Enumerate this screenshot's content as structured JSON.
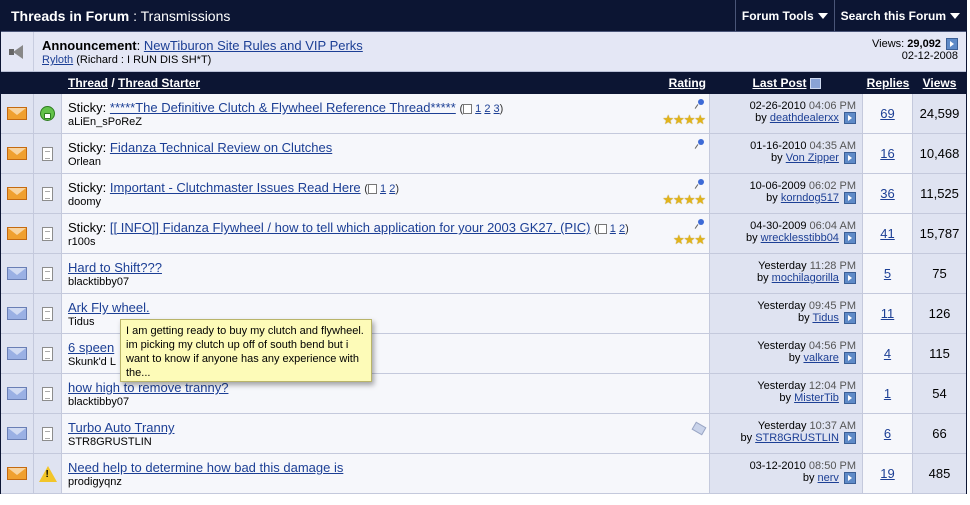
{
  "header": {
    "title_bold": "Threads in Forum",
    "title_rest": ": Transmissions",
    "forum_tools": "Forum Tools",
    "search_forum": "Search this Forum"
  },
  "announcement": {
    "label": "Announcement",
    "title": "NewTiburon Site Rules and VIP Perks",
    "author": "Ryloth",
    "author_title": "(Richard : I RUN DIS SH*T)",
    "views_label": "Views:",
    "views": "29,092",
    "date": "02-12-2008"
  },
  "columns": {
    "thread": "Thread",
    "sep": "/",
    "starter": "Thread Starter",
    "rating": "Rating",
    "last_post": "Last Post",
    "replies": "Replies",
    "views": "Views"
  },
  "tooltip": "I am getting ready to buy my clutch and flywheel. im picking my clutch up off of south bend but i want to know if anyone has any experience with the...",
  "threads": [
    {
      "prefix": "Sticky:",
      "title": "*****The Definitive Clutch & Flywheel Reference Thread*****",
      "pages": "1 2 3",
      "starter": "aLiEn_sPoReZ",
      "date": "02-26-2010",
      "time": "04:06 PM",
      "by": "by",
      "last_user": "deathdealerxx",
      "replies": "69",
      "views": "24,599",
      "stars": "★★★★"
    },
    {
      "prefix": "Sticky:",
      "title": "Fidanza Technical Review on Clutches",
      "pages": "",
      "starter": "Orlean",
      "date": "01-16-2010",
      "time": "04:35 AM",
      "by": "by",
      "last_user": "Von Zipper",
      "replies": "16",
      "views": "10,468",
      "stars": ""
    },
    {
      "prefix": "Sticky:",
      "title": "Important - Clutchmaster Issues Read Here",
      "pages": "1 2",
      "starter": "doomy",
      "date": "10-06-2009",
      "time": "06:02 PM",
      "by": "by",
      "last_user": "korndog517",
      "replies": "36",
      "views": "11,525",
      "stars": "★★★★"
    },
    {
      "prefix": "Sticky:",
      "title": "[[ INFO]] Fidanza Flywheel / how to tell which application for your 2003 GK27. (PIC)",
      "pages": "1 2",
      "starter": "r100s",
      "date": "04-30-2009",
      "time": "06:04 AM",
      "by": "by",
      "last_user": "wrecklesstibb04",
      "replies": "41",
      "views": "15,787",
      "stars": "★★★"
    },
    {
      "prefix": "",
      "title": "Hard to Shift???",
      "pages": "",
      "starter": "blacktibby07",
      "date": "Yesterday",
      "time": "11:28 PM",
      "by": "by",
      "last_user": "mochilagorilla",
      "replies": "5",
      "views": "75",
      "stars": ""
    },
    {
      "prefix": "",
      "title": "Ark Fly wheel.",
      "pages": "",
      "starter": "Tidus",
      "date": "Yesterday",
      "time": "09:45 PM",
      "by": "by",
      "last_user": "Tidus",
      "replies": "11",
      "views": "126",
      "stars": ""
    },
    {
      "prefix": "",
      "title": "6 speen",
      "pages": "",
      "starter": "Skunk'd L",
      "date": "Yesterday",
      "time": "04:56 PM",
      "by": "by",
      "last_user": "valkare",
      "replies": "4",
      "views": "115",
      "stars": ""
    },
    {
      "prefix": "",
      "title": "how high to remove tranny?",
      "pages": "",
      "starter": "blacktibby07",
      "date": "Yesterday",
      "time": "12:04 PM",
      "by": "by",
      "last_user": "MisterTib",
      "replies": "1",
      "views": "54",
      "stars": ""
    },
    {
      "prefix": "",
      "title": "Turbo Auto Tranny",
      "pages": "",
      "starter": "STR8GRUSTLIN",
      "date": "Yesterday",
      "time": "10:37 AM",
      "by": "by",
      "last_user": "STR8GRUSTLIN",
      "replies": "6",
      "views": "66",
      "stars": ""
    },
    {
      "prefix": "",
      "title": "Need help to determine how bad this damage is",
      "pages": "",
      "starter": "prodigyqnz",
      "date": "03-12-2010",
      "time": "08:50 PM",
      "by": "by",
      "last_user": "nerv",
      "replies": "19",
      "views": "485",
      "stars": ""
    }
  ]
}
